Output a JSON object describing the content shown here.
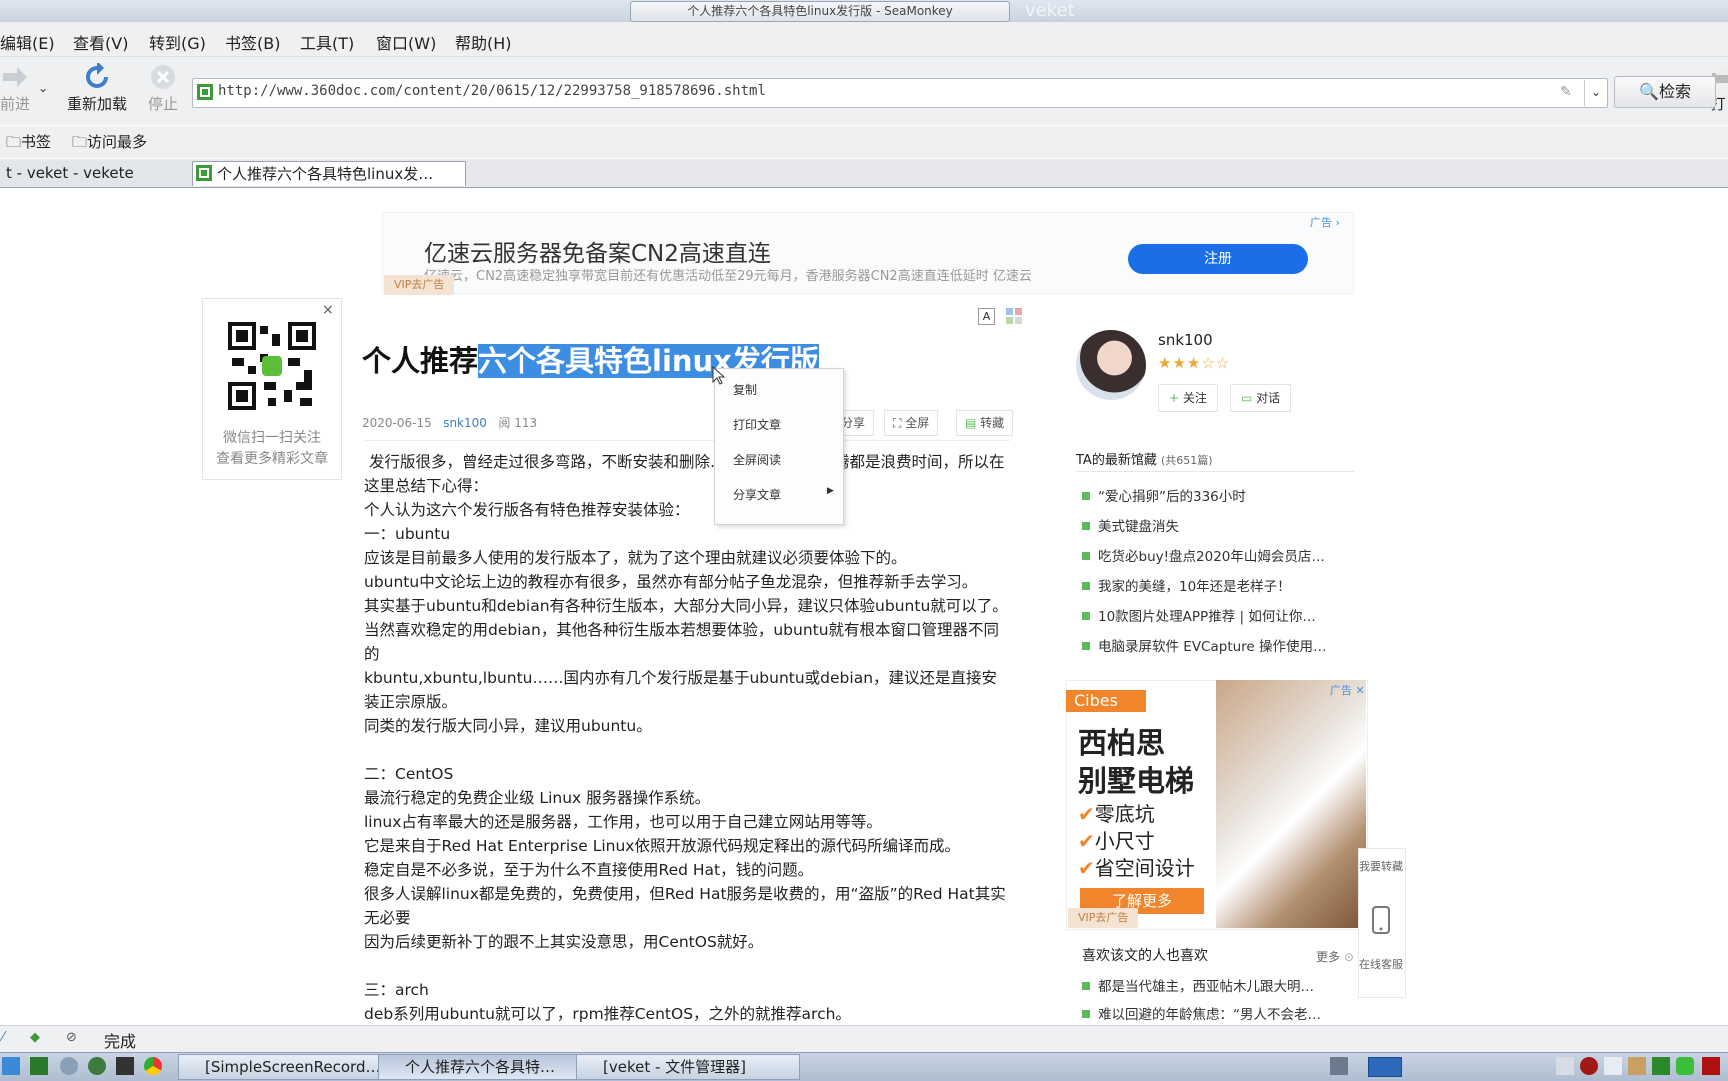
{
  "window": {
    "title": "个人推荐六个各具特色linux发行版 - SeaMonkey",
    "wm_name": "veket"
  },
  "menu": [
    "编辑(E)",
    "查看(V)",
    "转到(G)",
    "书签(B)",
    "工具(T)",
    "窗口(W)",
    "帮助(H)"
  ],
  "nav": {
    "forward": "前进",
    "reload": "重新加载",
    "stop": "停止",
    "print": "打",
    "url": "http://www.360doc.com/content/20/0615/12/22993758_918578696.shtml",
    "search": "检索"
  },
  "bookmarks": [
    "书签",
    "访问最多"
  ],
  "tabs": [
    {
      "label": "t - veket - vekete"
    },
    {
      "label": "个人推荐六个各具特色linux发…"
    }
  ],
  "ad_top": {
    "title": "亿速云服务器免备案CN2高速直连",
    "sub": "亿速云，CN2高速稳定独享带宽目前还有优惠活动低至29元每月，香港服务器CN2高速直连低延时 亿速云",
    "button": "注册",
    "tag": "广告",
    "vip": "VIP去广告"
  },
  "qr": {
    "line1": "微信扫一扫关注",
    "line2": "查看更多精彩文章",
    "close": "×"
  },
  "article": {
    "title_pre": "个人推荐",
    "title_hl": "六个各具特色linux发行版",
    "date": "2020-06-15",
    "author": "snk100",
    "reads": "阅 113",
    "font_btn": "A",
    "tools": {
      "share": "分享",
      "fullscreen": "全屏",
      "save": "转藏"
    },
    "body": [
      " 发行版很多，曾经走过很多弯路，不断安装和删除……发现大部分折腾都是浪费时间，所以在这里总结下心得：",
      "个人认为这六个发行版各有特色推荐安装体验：",
      "一：ubuntu",
      "应该是目前最多人使用的发行版本了，就为了这个理由就建议必须要体验下的。",
      "ubuntu中文论坛上边的教程亦有很多，虽然亦有部分帖子鱼龙混杂，但推荐新手去学习。",
      "其实基于ubuntu和debian有各种衍生版本，大部分大同小异，建议只体验ubuntu就可以了。",
      "当然喜欢稳定的用debian，其他各种衍生版本若想要体验，ubuntu就有根本窗口管理器不同的",
      "kbuntu,xbuntu,lbuntu……国内亦有几个发行版是基于ubuntu或debian，建议还是直接安装正宗原版。",
      "同类的发行版大同小异，建议用ubuntu。",
      "",
      "二：CentOS",
      "最流行稳定的免费企业级 Linux 服务器操作系统。",
      "linux占有率最大的还是服务器，工作用，也可以用于自己建立网站用等等。",
      "它是来自于Red Hat Enterprise Linux依照开放源代码规定释出的源代码所编译而成。",
      "稳定自是不必多说，至于为什么不直接使用Red Hat，钱的问题。",
      "很多人误解linux都是免费的，免费使用，但Red Hat服务是收费的，用“盗版”的Red Hat其实无必要",
      "因为后续更新补丁的跟不上其实没意思，用CentOS就好。",
      "",
      "三：arch",
      "deb系列用ubuntu就可以了，rpm推荐CentOS，之外的就推荐arch。"
    ]
  },
  "context_menu": [
    "复制",
    "打印文章",
    "全屏阅读",
    "分享文章"
  ],
  "author_card": {
    "name": "snk100",
    "stars": "★★★☆☆",
    "follow": "关注",
    "chat": "对话"
  },
  "latest": {
    "header": "TA的最新馆藏",
    "count": "(共651篇)",
    "items": [
      "“爱心捐卵”后的336小时",
      "美式键盘消失",
      "吃货必buy!盘点2020年山姆会员店…",
      "我家的美缝，10年还是老样子！",
      "10款图片处理APP推荐 | 如何让你…",
      "电脑录屏软件 EVCapture 操作使用…"
    ]
  },
  "ad_right": {
    "logo": "Cibes",
    "line1": "西柏思",
    "line2": "别墅电梯",
    "checks": [
      "零底坑",
      "小尺寸",
      "省空间设计"
    ],
    "check_mark": "✔",
    "button": "了解更多",
    "tag": "广告",
    "vip": "VIP去广告"
  },
  "likes": {
    "header": "喜欢该文的人也喜欢",
    "more": "更多",
    "items": [
      "都是当代雄主，西亚帖木儿跟大明…",
      "难以回避的年龄焦虑：“男人不会老…"
    ]
  },
  "side_float": {
    "a": "我要转藏",
    "b": "在线客服"
  },
  "status": "完成",
  "taskbar": [
    {
      "label": "[SimpleScreenRecord…"
    },
    {
      "label": "个人推荐六个各具特…"
    },
    {
      "label": "[veket - 文件管理器]"
    }
  ],
  "colors": {
    "highlight": "#3d8de3",
    "ad_button": "#1a6ee8",
    "cibes_orange": "#f0852c",
    "list_bullet": "#5dbb5d"
  }
}
